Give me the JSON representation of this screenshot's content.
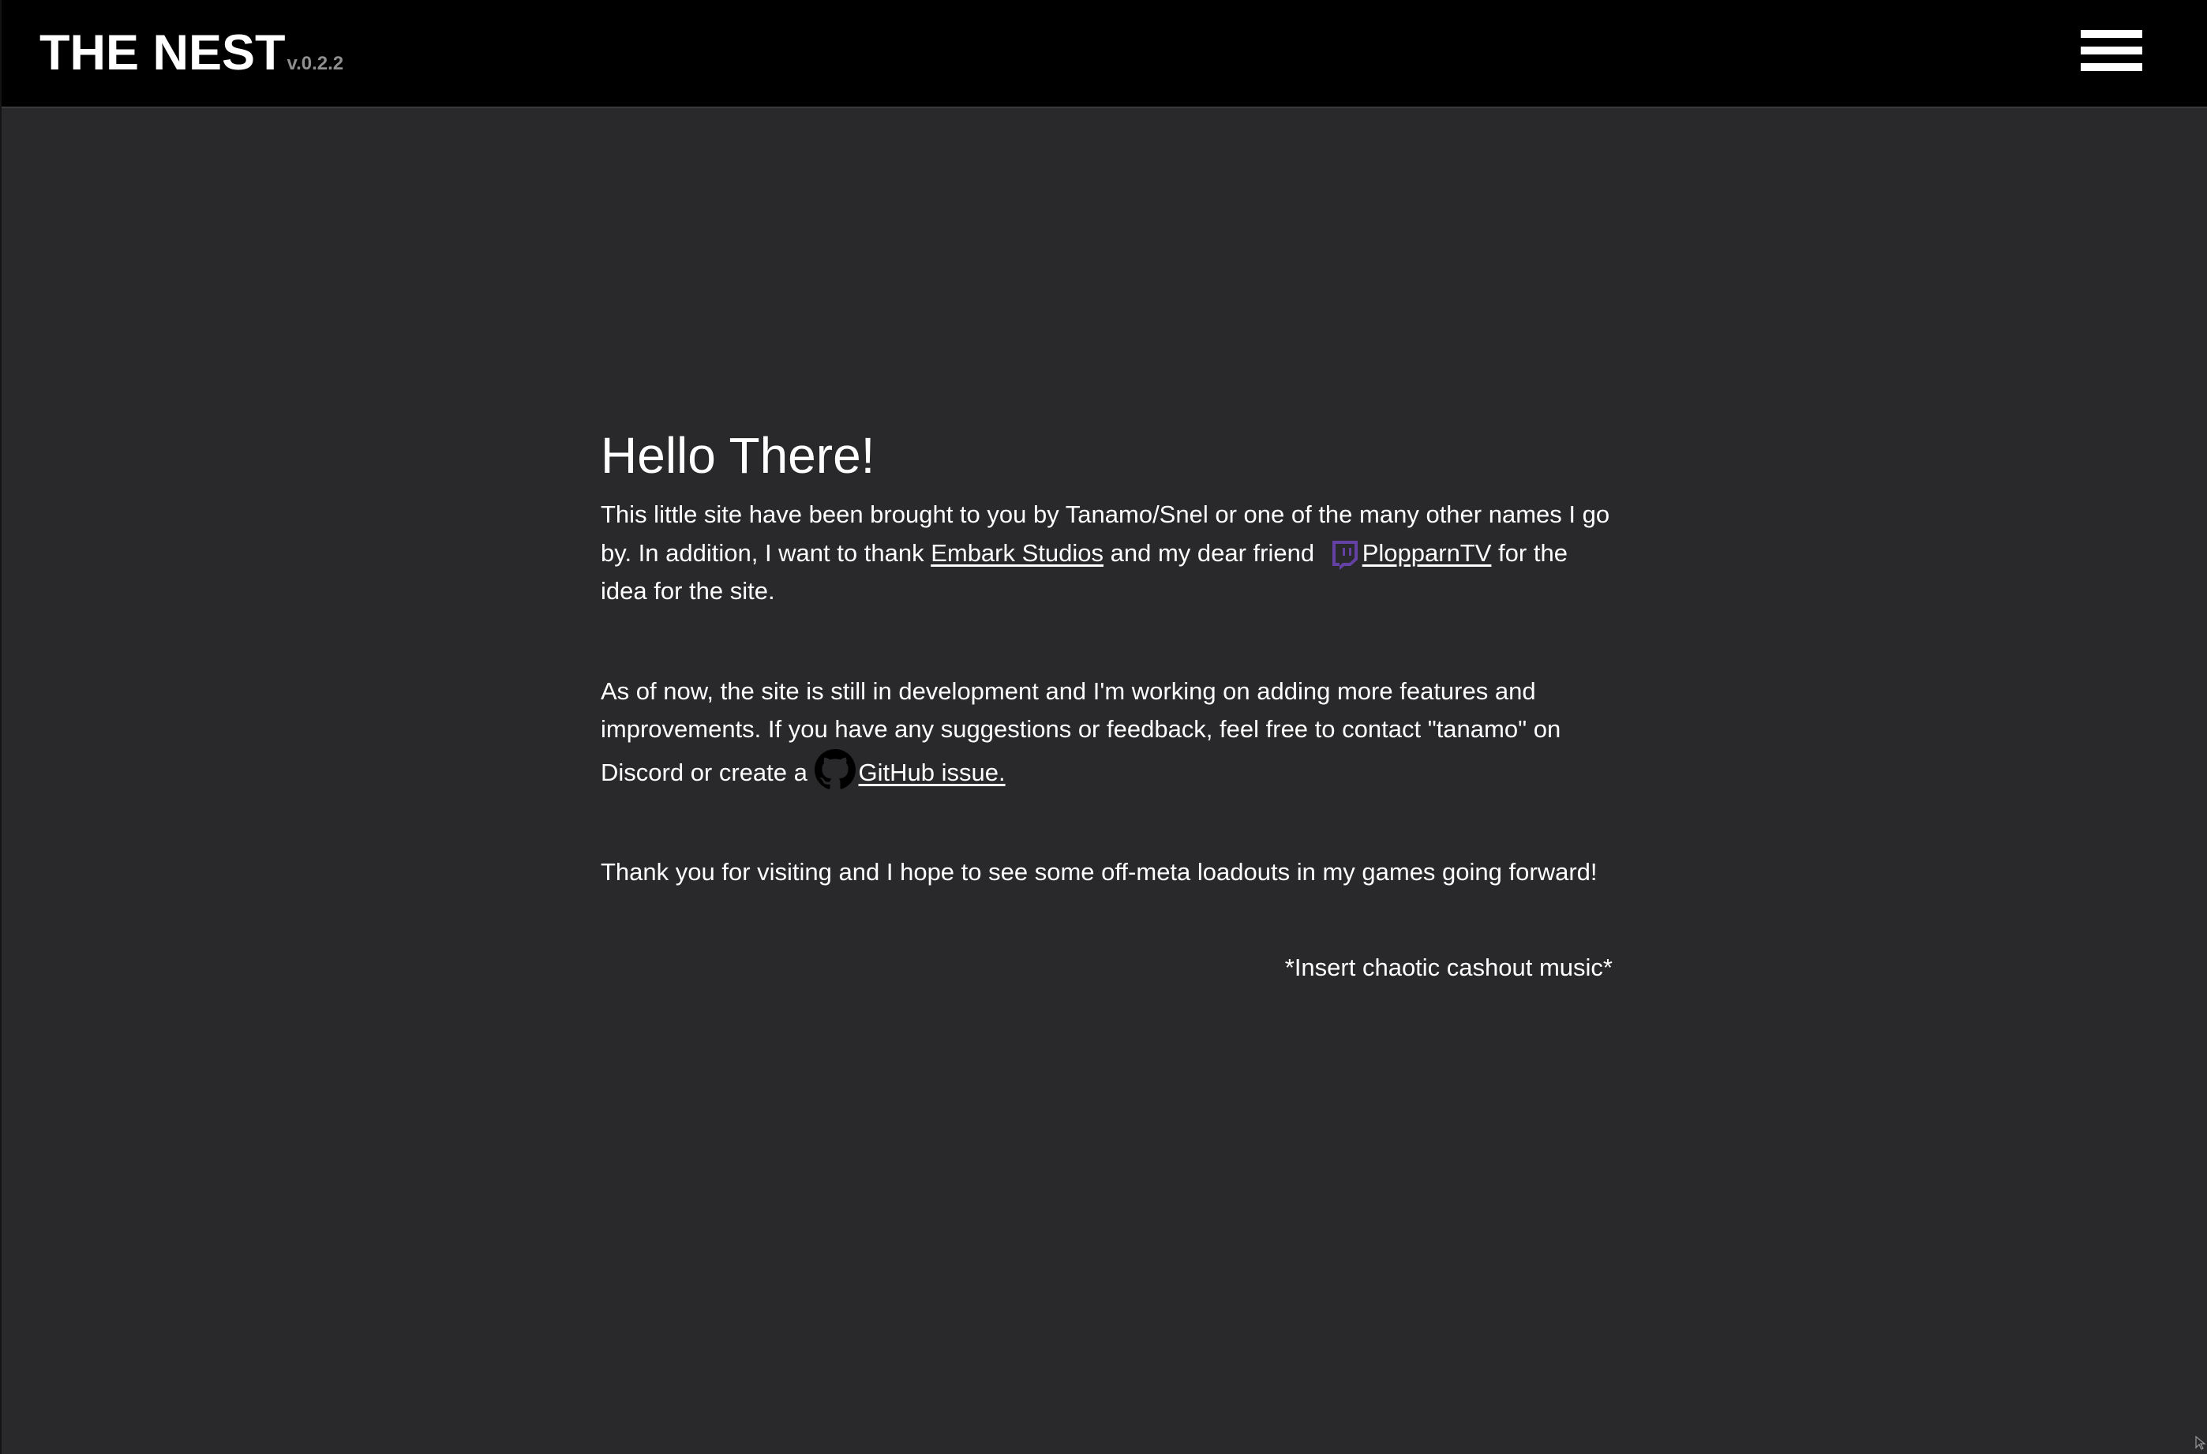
{
  "header": {
    "title": "THE NEST",
    "version": "v.0.2.2",
    "menu_icon": "hamburger-menu-icon"
  },
  "main": {
    "heading": "Hello There!",
    "intro": {
      "text_before_embark": "This little site have been brought to you by Tanamo/Snel or one of the many other names I go by. In addition, I want to thank ",
      "embark_link": "Embark Studios",
      "text_before_friend": " and my dear friend ",
      "friend_icon": "twitch-icon",
      "friend_link": "PlopparnTV",
      "text_after_friend": " for the idea for the site."
    },
    "development": {
      "text_before_link": "As of now, the site is still in development and I'm working on adding more features and improvements. If you have any suggestions or feedback, feel free to contact \"tanamo\" on Discord or create a ",
      "github_icon": "github-icon",
      "github_link": "GitHub issue."
    },
    "thanks": "Thank you for visiting and I hope to see some off-meta loadouts in my games going forward!",
    "signature": "*Insert chaotic cashout music*"
  },
  "colors": {
    "background": "#29292b",
    "header_background": "#000000",
    "text": "#ffffff",
    "version_text": "#8f8f8f",
    "twitch_purple": "#6441a5"
  }
}
